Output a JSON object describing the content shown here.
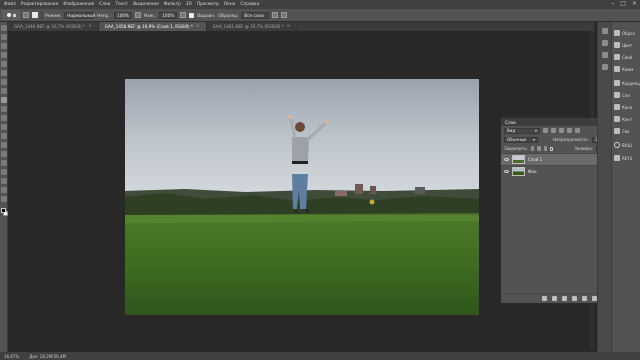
{
  "menu": {
    "items": [
      "Файл",
      "Редактирование",
      "Изображение",
      "Слои",
      "Текст",
      "Выделение",
      "Фильтр",
      "3D",
      "Просмотр",
      "Окно",
      "Справка"
    ]
  },
  "window_controls": [
    "–",
    "□",
    "×"
  ],
  "options_bar": {
    "mode_label": "Режим:",
    "mode_value": "Нормальный",
    "opacity_label": "Непр.:",
    "opacity_value": "100%",
    "flow_label": "Наж.:",
    "flow_value": "100%",
    "pressure_label": "Нажим:",
    "pressure_value": "100%",
    "align_label": "Выравн.",
    "sample_label": "Образец:",
    "sample_value": "Все слои"
  },
  "tabs": [
    {
      "label": "GAA_1446.NEF @ 16,7% (RGB/8) *",
      "active": false
    },
    {
      "label": "GAA_1458.NEF @ 16,9% (Слой 1, RGB/8) *",
      "active": true
    },
    {
      "label": "GAA_1461.NEF @ 16,7% (RGB/8) *",
      "active": false
    }
  ],
  "status": {
    "zoom": "16,67%",
    "doc": "Док: 28,2M/56,4M"
  },
  "layers_panel": {
    "title": "Слои",
    "filter_label": "Вид",
    "blend_mode": "Обычные",
    "opacity_label": "Непрозрачность:",
    "opacity_value": "100%",
    "lock_label": "Закрепить:",
    "fill_label": "Заливка:",
    "fill_value": "100%",
    "layers": [
      {
        "name": "Слой 1",
        "selected": true
      },
      {
        "name": "Фон",
        "selected": false
      }
    ]
  },
  "right_dock": {
    "items": [
      "Образ",
      "Цвет",
      "Свой",
      "Комм",
      "Коррекц",
      "Сли",
      "Кана",
      "Конт",
      "Сво",
      "ВАШ",
      "REYS"
    ]
  },
  "colors": {
    "accent_selected_layer": "#6a6a6a",
    "canvas_bg": "#282828",
    "panel_bg": "#535353"
  }
}
